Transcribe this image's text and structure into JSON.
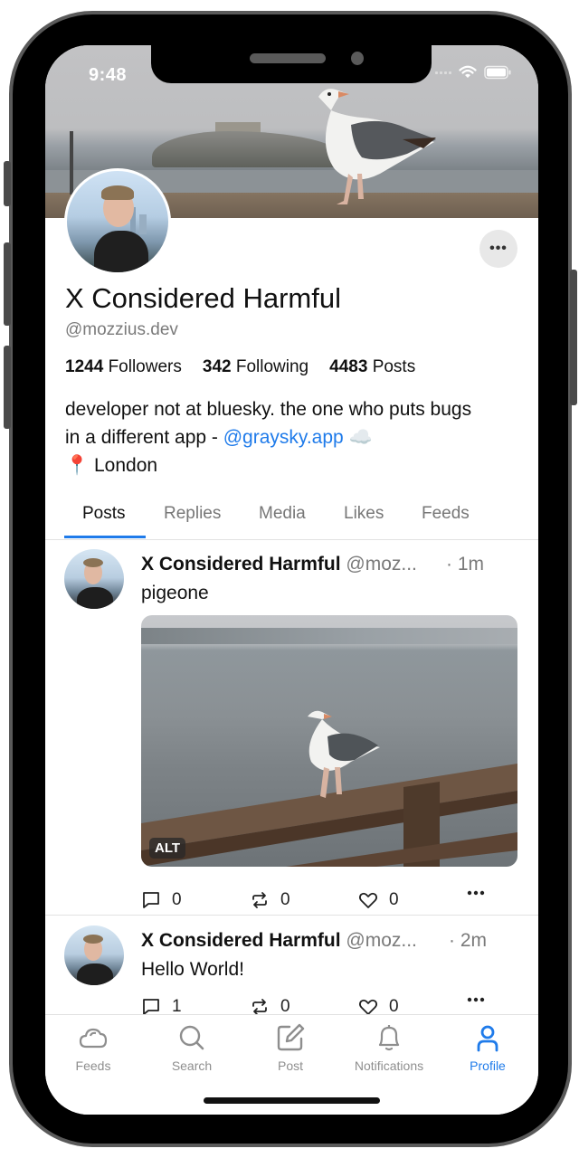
{
  "status_bar": {
    "time": "9:48"
  },
  "profile": {
    "display_name": "X Considered Harmful",
    "handle": "@mozzius.dev",
    "stats": {
      "followers_count": "1244",
      "followers_label": "Followers",
      "following_count": "342",
      "following_label": "Following",
      "posts_count": "4483",
      "posts_label": "Posts"
    },
    "bio": {
      "line1": "developer not at bluesky. the one who puts bugs",
      "line2_prefix": "in a different app - ",
      "line2_link": "@graysky.app",
      "line2_emoji": "☁️",
      "location_emoji": "📍",
      "location": "London"
    },
    "more_label": "•••"
  },
  "tabs": [
    {
      "label": "Posts",
      "active": true
    },
    {
      "label": "Replies",
      "active": false
    },
    {
      "label": "Media",
      "active": false
    },
    {
      "label": "Likes",
      "active": false
    },
    {
      "label": "Feeds",
      "active": false
    }
  ],
  "posts": [
    {
      "author": "X Considered Harmful",
      "handle": "@moz...",
      "time": "· 1m",
      "text": "pigeone",
      "image_alt_badge": "ALT",
      "replies": "0",
      "reposts": "0",
      "likes": "0"
    },
    {
      "author": "X Considered Harmful",
      "handle": "@moz...",
      "time": "· 2m",
      "text": "Hello World!",
      "replies": "1",
      "reposts": "0",
      "likes": "0"
    }
  ],
  "tabbar": [
    {
      "label": "Feeds",
      "icon": "cloud-icon",
      "active": false
    },
    {
      "label": "Search",
      "icon": "search-icon",
      "active": false
    },
    {
      "label": "Post",
      "icon": "compose-icon",
      "active": false
    },
    {
      "label": "Notifications",
      "icon": "bell-icon",
      "active": false
    },
    {
      "label": "Profile",
      "icon": "person-icon",
      "active": true
    }
  ],
  "colors": {
    "accent": "#1f7bea",
    "muted": "#7a7a7a",
    "divider": "#e2e2e2"
  }
}
